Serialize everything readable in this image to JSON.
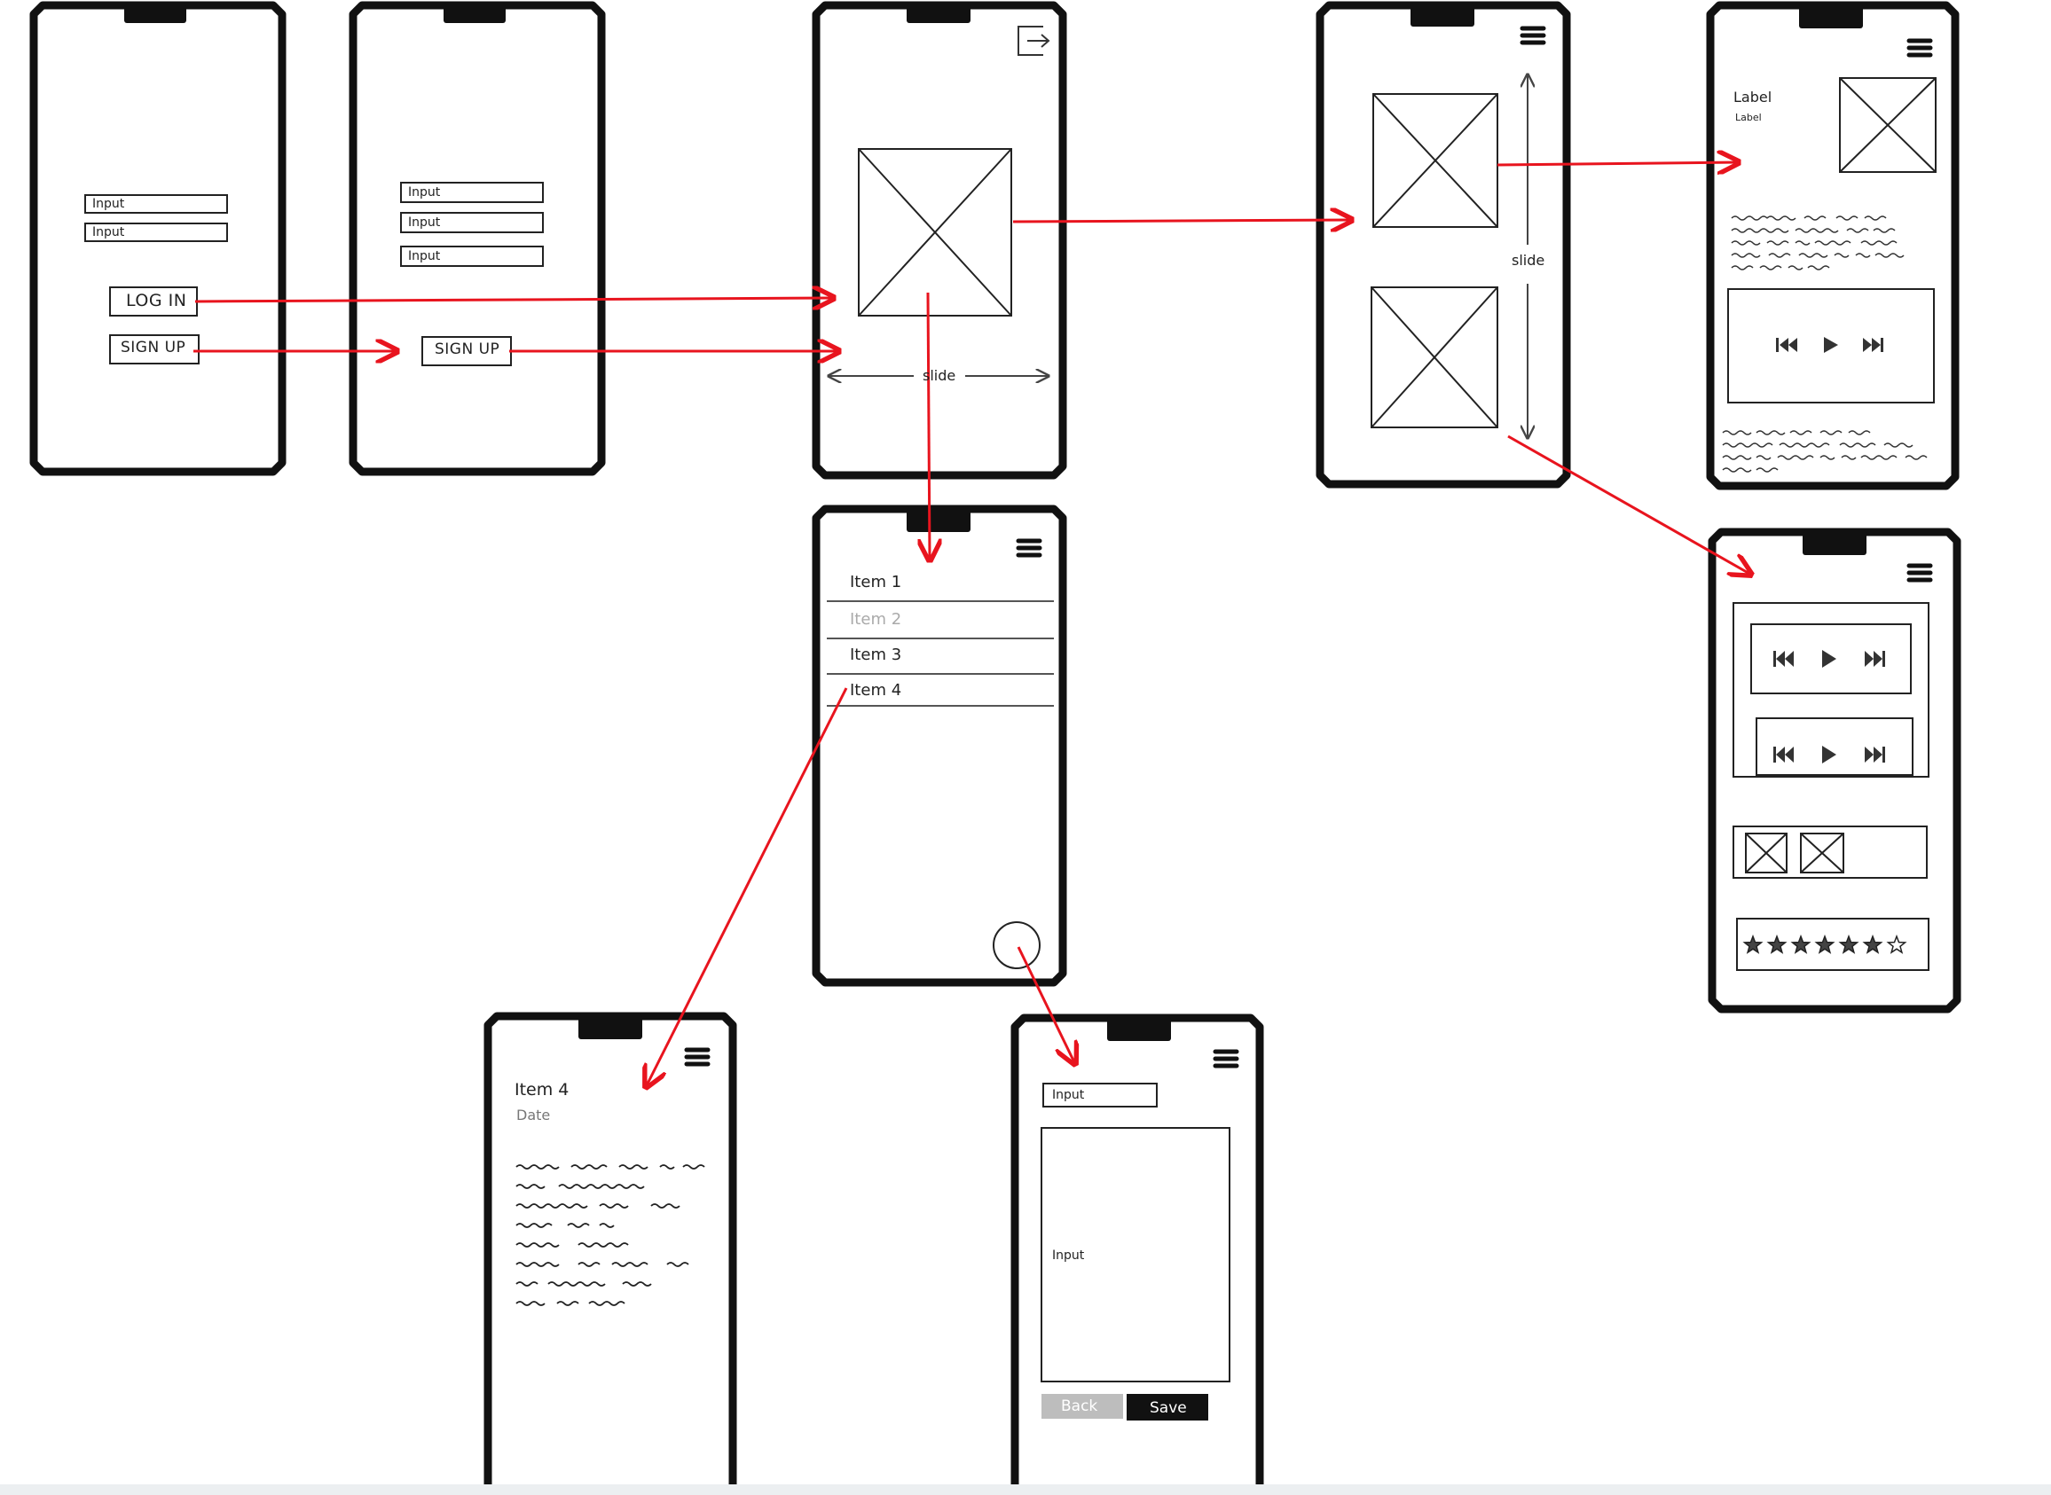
{
  "colors": {
    "stroke": "#111111",
    "flow_arrow": "#e8141e",
    "muted_text": "#aaaaaa",
    "back_button_bg": "#bdbdbd",
    "save_button_bg": "#111111"
  },
  "login_screen": {
    "input1": "Input",
    "input2": "Input",
    "login_button": "LOG IN",
    "signup_button": "SIGN UP"
  },
  "signup_screen": {
    "input1": "Input",
    "input2": "Input",
    "input3": "Input",
    "signup_button": "SIGN UP"
  },
  "home_screen": {
    "slide_label": "slide",
    "logout_icon": "logout-icon"
  },
  "gallery_screen": {
    "slide_label": "slide",
    "menu_icon": "hamburger-icon"
  },
  "detail_screen": {
    "label_title": "Label",
    "label_sub": "Label",
    "menu_icon": "hamburger-icon"
  },
  "list_screen": {
    "items": [
      "Item 1",
      "Item 2",
      "Item 3",
      "Item 4"
    ]
  },
  "item_detail_screen": {
    "title": "Item 4",
    "date": "Date"
  },
  "edit_screen": {
    "input_label": "Input",
    "body_label": "Input",
    "back_button": "Back",
    "save_button": "Save"
  },
  "media_screen": {
    "rating": {
      "filled": 6,
      "total": 7
    }
  }
}
